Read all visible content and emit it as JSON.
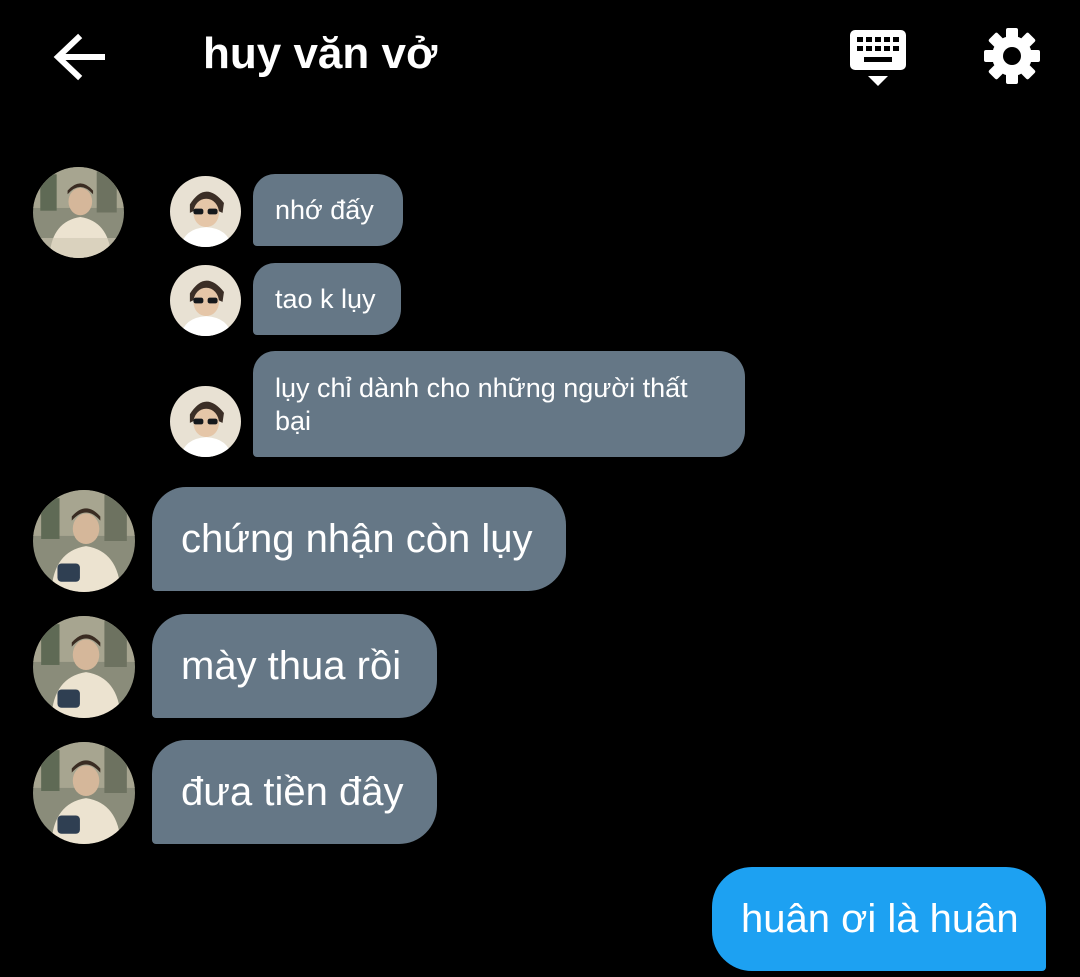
{
  "header": {
    "title": "huy văn vở"
  },
  "colors": {
    "background": "#000000",
    "incoming_bubble": "#657786",
    "outgoing_bubble": "#1da1f2",
    "text": "#ffffff"
  },
  "icons": {
    "back": "arrow-left-icon",
    "keyboard": "keyboard-hide-icon",
    "settings": "gear-icon"
  },
  "messages": {
    "quoted": [
      {
        "text": "nhớ đấy"
      },
      {
        "text": "tao k lụy"
      },
      {
        "text": "lụy chỉ dành cho những người thất bại"
      }
    ],
    "incoming": [
      {
        "text": "chứng nhận còn lụy"
      },
      {
        "text": "mày thua rồi"
      },
      {
        "text": "đưa tiền đây"
      }
    ],
    "outgoing": [
      {
        "text": "huân ơi là huân"
      }
    ]
  }
}
